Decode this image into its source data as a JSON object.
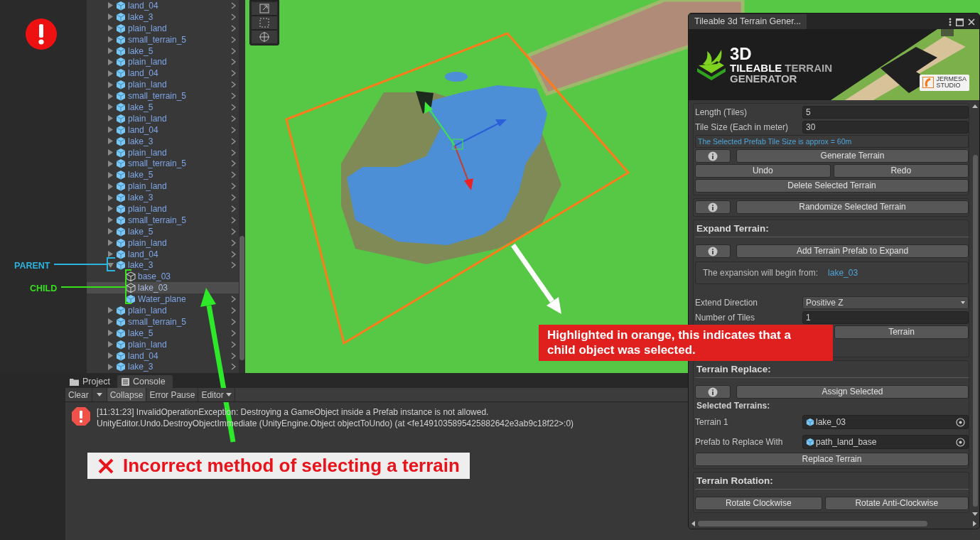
{
  "hierarchy": {
    "items": [
      {
        "name": "land_04",
        "kind": "prefab",
        "expanded": false,
        "selected": false
      },
      {
        "name": "lake_3",
        "kind": "prefab",
        "expanded": false,
        "selected": false
      },
      {
        "name": "plain_land",
        "kind": "prefab",
        "expanded": false,
        "selected": false
      },
      {
        "name": "small_terrain_5",
        "kind": "prefab",
        "expanded": false,
        "selected": false
      },
      {
        "name": "lake_5",
        "kind": "prefab",
        "expanded": false,
        "selected": false
      },
      {
        "name": "plain_land",
        "kind": "prefab",
        "expanded": false,
        "selected": false
      },
      {
        "name": "land_04",
        "kind": "prefab",
        "expanded": false,
        "selected": false
      },
      {
        "name": "plain_land",
        "kind": "prefab",
        "expanded": false,
        "selected": false
      },
      {
        "name": "small_terrain_5",
        "kind": "prefab",
        "expanded": false,
        "selected": false
      },
      {
        "name": "lake_5",
        "kind": "prefab",
        "expanded": false,
        "selected": false
      },
      {
        "name": "plain_land",
        "kind": "prefab",
        "expanded": false,
        "selected": false
      },
      {
        "name": "land_04",
        "kind": "prefab",
        "expanded": false,
        "selected": false
      },
      {
        "name": "lake_3",
        "kind": "prefab",
        "expanded": false,
        "selected": false
      },
      {
        "name": "plain_land",
        "kind": "prefab",
        "expanded": false,
        "selected": false
      },
      {
        "name": "small_terrain_5",
        "kind": "prefab",
        "expanded": false,
        "selected": false
      },
      {
        "name": "lake_5",
        "kind": "prefab",
        "expanded": false,
        "selected": false
      },
      {
        "name": "plain_land",
        "kind": "prefab",
        "expanded": false,
        "selected": false
      },
      {
        "name": "lake_3",
        "kind": "prefab",
        "expanded": false,
        "selected": false
      },
      {
        "name": "plain_land",
        "kind": "prefab",
        "expanded": false,
        "selected": false
      },
      {
        "name": "small_terrain_5",
        "kind": "prefab",
        "expanded": false,
        "selected": false
      },
      {
        "name": "lake_5",
        "kind": "prefab",
        "expanded": false,
        "selected": false
      },
      {
        "name": "plain_land",
        "kind": "prefab",
        "expanded": false,
        "selected": false
      },
      {
        "name": "land_04",
        "kind": "prefab",
        "expanded": false,
        "selected": false
      },
      {
        "name": "lake_3",
        "kind": "prefab",
        "expanded": true,
        "selected": false,
        "children": [
          {
            "name": "base_03",
            "kind": "object",
            "selected": false
          },
          {
            "name": "lake_03",
            "kind": "object",
            "selected": true
          },
          {
            "name": "Water_plane",
            "kind": "prefab",
            "selected": false
          }
        ]
      },
      {
        "name": "plain_land",
        "kind": "prefab",
        "expanded": false,
        "selected": false
      },
      {
        "name": "small_terrain_5",
        "kind": "prefab",
        "expanded": false,
        "selected": false
      },
      {
        "name": "lake_5",
        "kind": "prefab",
        "expanded": false,
        "selected": false
      },
      {
        "name": "plain_land",
        "kind": "prefab",
        "expanded": false,
        "selected": false
      },
      {
        "name": "land_04",
        "kind": "prefab",
        "expanded": false,
        "selected": false
      },
      {
        "name": "lake_3",
        "kind": "prefab",
        "expanded": false,
        "selected": false
      }
    ]
  },
  "annotations": {
    "parent_label": "PARENT",
    "child_label": "CHILD",
    "scene_callout": "Highlighted in orange, this indicates that a child object was selected.",
    "console_callout": "Incorrect method of selecting a terrain"
  },
  "console": {
    "tabs": [
      {
        "label": "Project",
        "selected": false
      },
      {
        "label": "Console",
        "selected": true
      }
    ],
    "toolbar": [
      {
        "kind": "button",
        "label": "Clear"
      },
      {
        "kind": "caret"
      },
      {
        "kind": "toggle",
        "label": "Collapse",
        "on": true
      },
      {
        "kind": "toggle",
        "label": "Error Pause",
        "on": false
      },
      {
        "kind": "dropdown",
        "label": "Editor"
      }
    ],
    "entries": [
      {
        "lines": [
          "[11:31:23] InvalidOperationException: Destroying a GameObject inside a Prefab instance is not allowed.",
          "UnityEditor.Undo.DestroyObjectImmediate (UnityEngine.Object objectToUndo) (at <fe1491035895425882642e3ab9c18f22>:0)"
        ]
      }
    ]
  },
  "tool_window": {
    "title": "Tileable 3d Terrain Gener...",
    "banner": {
      "big": "3D",
      "word_a": "TILEABLE",
      "word_b": "TERRAIN",
      "word_c": "GENERATOR",
      "studio": "JERMESA",
      "studio_sub": "STUDIO"
    },
    "groups": [
      {
        "rows": [
          {
            "kind": "field",
            "label": "Length (Tiles)",
            "value": "5"
          },
          {
            "kind": "field",
            "label": "Tile Size (Each in meter)",
            "value": "30"
          },
          {
            "kind": "note",
            "text": "The Selected Prefab Tile Size is approx = 60m"
          },
          {
            "kind": "info-button",
            "label": "Generate Terrain"
          },
          {
            "kind": "button-pair",
            "labels": [
              "Undo",
              "Redo"
            ]
          },
          {
            "kind": "button",
            "label": "Delete Selected Terrain"
          }
        ]
      },
      {
        "rows": [
          {
            "kind": "info-button",
            "label": "Randomize Selected Terrain"
          }
        ]
      },
      {
        "title": "Expand Terrain:",
        "rows": [
          {
            "kind": "info-button",
            "label": "Add Terrain Prefab to Expand"
          },
          {
            "kind": "begin-note",
            "text": "The expansion will begin from:",
            "value": "lake_03"
          },
          {
            "kind": "dropdown",
            "label": "Extend Direction",
            "value": "Positive Z"
          },
          {
            "kind": "field",
            "label": "Number of Tiles",
            "value": "1"
          },
          {
            "kind": "covered-button",
            "label": "Terrain"
          }
        ]
      },
      {
        "title": "Terrain Replace:",
        "rows": [
          {
            "kind": "info-button",
            "label": "Assign Selected"
          },
          {
            "kind": "subheading",
            "text": "Selected Terrains:"
          },
          {
            "kind": "object-field",
            "label": "Terrain 1",
            "value": "lake_03"
          },
          {
            "kind": "object-field",
            "label": "Prefab to Replace With",
            "value": "path_land_base"
          },
          {
            "kind": "button",
            "label": "Replace Terrain"
          }
        ]
      },
      {
        "title": "Terrain Rotation:",
        "rows": [
          {
            "kind": "button-pair",
            "labels": [
              "Rotate Clockwise",
              "Rotate Anti-Clockwise"
            ]
          }
        ]
      }
    ]
  }
}
